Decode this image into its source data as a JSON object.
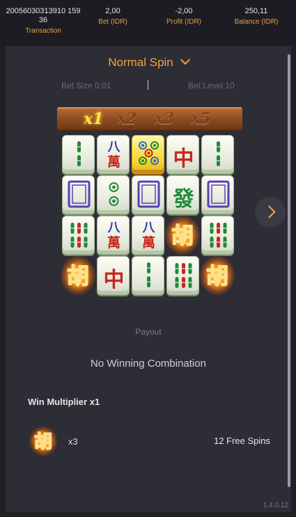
{
  "header": {
    "transaction": {
      "value": "20056030313910 15936",
      "label": "Transaction"
    },
    "bet": {
      "value": "2,00",
      "label": "Bet (IDR)"
    },
    "profit": {
      "value": "-2,00",
      "label": "Profit (IDR)"
    },
    "balance": {
      "value": "250,11",
      "label": "Balance (IDR)"
    }
  },
  "spin": {
    "title": "Normal Spin",
    "icon": "chevron-down-icon"
  },
  "bet_info": {
    "bet_size": "Bet Size 0,01",
    "bet_level": "Bet Level 10"
  },
  "multipliers": {
    "labels": [
      "x1",
      "x2",
      "x3",
      "x5"
    ],
    "active_index": 0
  },
  "reels": {
    "rows": [
      [
        "bamboo-2",
        "character-8-wan",
        "dots-5-gold",
        "red-dragon",
        "bamboo-2"
      ],
      [
        "white-dragon",
        "dots-2",
        "white-dragon",
        "green-dragon",
        "white-dragon"
      ],
      [
        "bamboo-6",
        "character-8-wan",
        "character-8-wan",
        "hu-wild",
        "bamboo-6"
      ],
      [
        "hu-wild",
        "red-dragon",
        "bamboo-2",
        "bamboo-6",
        "hu-wild"
      ]
    ],
    "glyphs": {
      "eight": "八",
      "wan": "萬",
      "red_dragon": "中",
      "green_dragon": "發",
      "hu": "胡"
    }
  },
  "payout": {
    "label": "Payout",
    "result": "No Winning Combination",
    "win_multiplier": "Win Multiplier x1",
    "scatter_icon": "hu-scatter-icon",
    "scatter_count": "x3",
    "free_spins": "12 Free Spins"
  },
  "version": "1.4.0.12",
  "colors": {
    "accent": "#f0a43e",
    "panel": "#2d2d36",
    "header": "#1c1c22"
  }
}
